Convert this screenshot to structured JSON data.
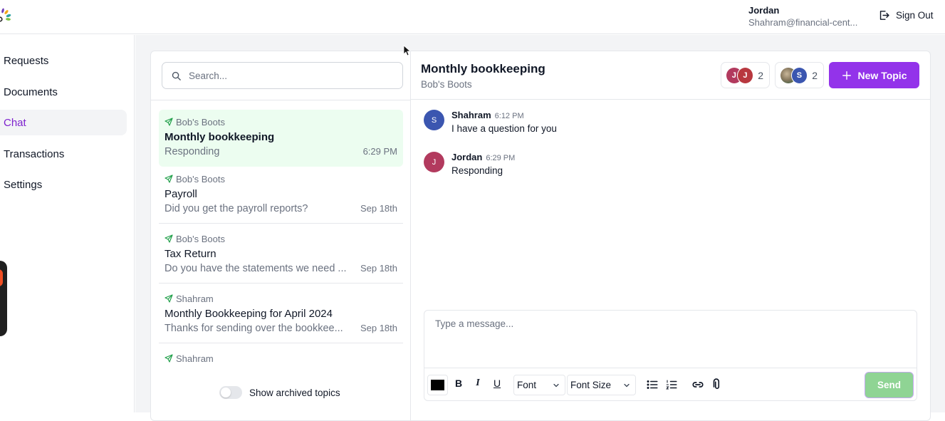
{
  "header": {
    "logo": "app-logo",
    "user_name": "Jordan",
    "user_email": "Shahram@financial-cent...",
    "sign_out_label": "Sign Out",
    "sign_out_icon": "sign-out-icon"
  },
  "sidebar": {
    "items": [
      {
        "label": "Requests",
        "active": false
      },
      {
        "label": "Documents",
        "active": false
      },
      {
        "label": "Chat",
        "active": true
      },
      {
        "label": "Transactions",
        "active": false
      },
      {
        "label": "Settings",
        "active": false
      }
    ]
  },
  "topics_panel": {
    "search": {
      "placeholder": "Search...",
      "value": "",
      "icon": "search-icon"
    },
    "topics": [
      {
        "client": "Bob's Boots",
        "title": "Monthly bookkeeping",
        "preview": "Responding",
        "time": "6:29 PM",
        "active": true
      },
      {
        "client": "Bob's Boots",
        "title": "Payroll",
        "preview": "Did you get the payroll reports?",
        "time": "Sep 18th",
        "active": false
      },
      {
        "client": "Bob's Boots",
        "title": "Tax Return",
        "preview": "Do you have the statements we need ...",
        "time": "Sep 18th",
        "active": false
      },
      {
        "client": "Shahram",
        "title": "Monthly Bookkeeping for April 2024",
        "preview": "Thanks for sending over the bookkee...",
        "time": "Sep 18th",
        "active": false
      },
      {
        "client": "Shahram",
        "title": "",
        "preview": "",
        "time": "",
        "active": false
      }
    ],
    "archived_toggle": {
      "label": "Show archived topics",
      "on": false
    }
  },
  "conversation": {
    "title": "Monthly bookkeeping",
    "subtitle": "Bob's Boots",
    "participant_groups": [
      {
        "avatars": [
          {
            "initial": "J",
            "color": "#b23a5e"
          },
          {
            "initial": "J",
            "color": "#b8383f"
          }
        ],
        "count": "2"
      },
      {
        "avatars": [
          {
            "initial": "",
            "color": "photo"
          },
          {
            "initial": "S",
            "color": "#3b56b0"
          }
        ],
        "count": "2"
      }
    ],
    "new_topic_label": "New Topic",
    "accent": "#9333ea",
    "messages": [
      {
        "author": "Shahram",
        "initial": "S",
        "avatar_color": "#3b56b0",
        "time": "6:12 PM",
        "text": "I have a question for you"
      },
      {
        "author": "Jordan",
        "initial": "J",
        "avatar_color": "#b23a5e",
        "time": "6:29 PM",
        "text": "Responding"
      }
    ],
    "composer": {
      "placeholder": "Type a message...",
      "value": "",
      "text_color": "#000000",
      "bold_label": "B",
      "italic_label": "I",
      "underline_label": "U",
      "font_select": "Font",
      "font_size_select": "Font Size",
      "send_label": "Send",
      "send_color": "#8fd494"
    }
  }
}
